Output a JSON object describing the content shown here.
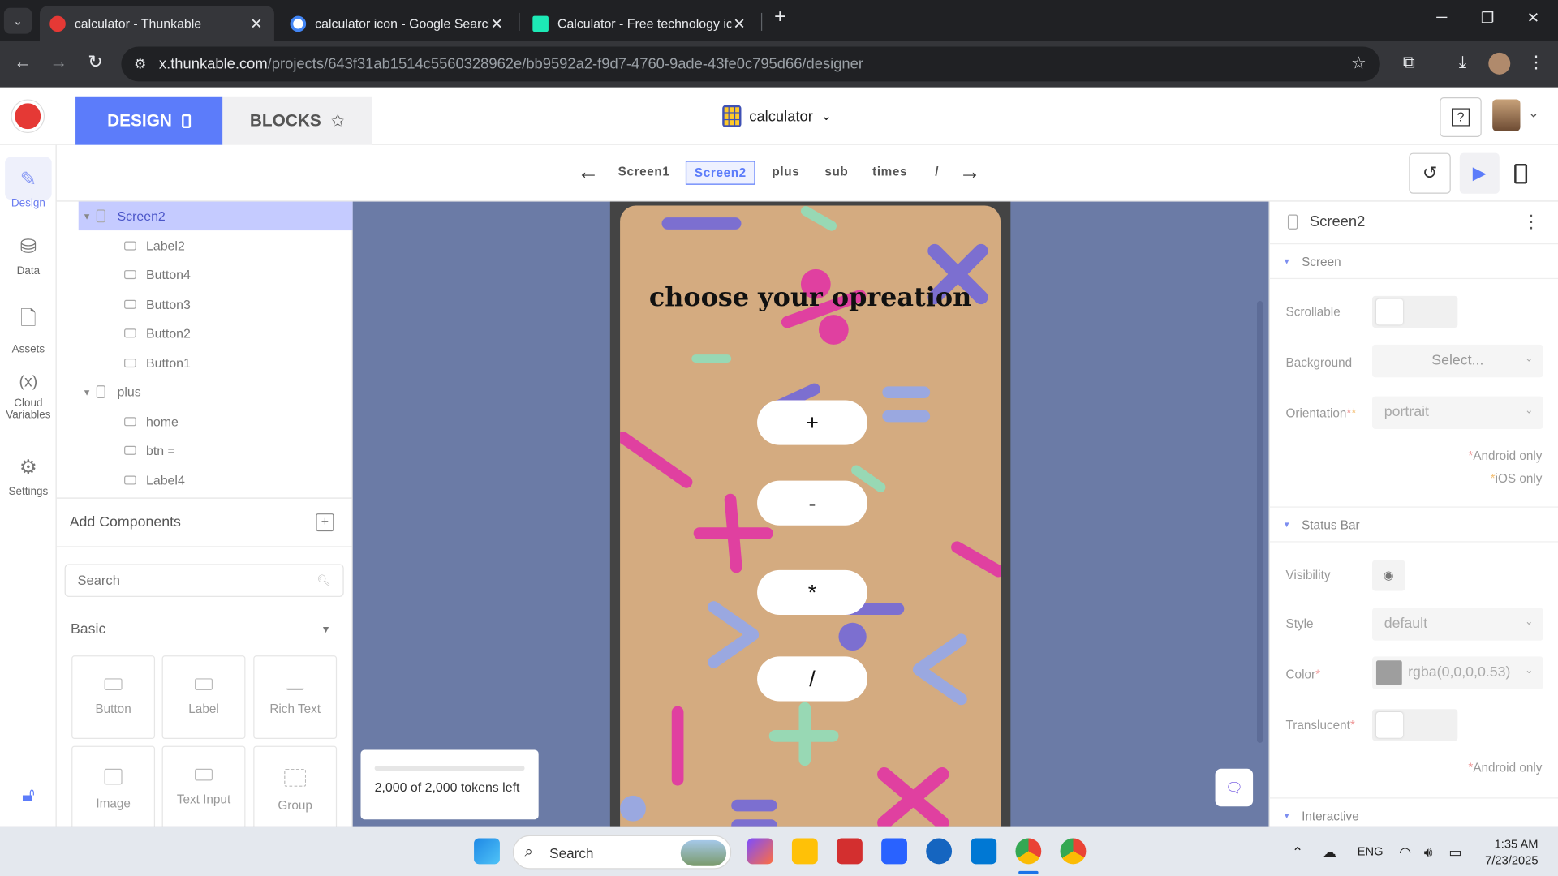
{
  "browser": {
    "tabs": [
      {
        "title": "calculator - Thunkable",
        "active": true
      },
      {
        "title": "calculator icon - Google Search",
        "active": false
      },
      {
        "title": "Calculator - Free technology icons",
        "active": false
      }
    ],
    "new_tab": "+",
    "url_host": "x.thunkable.com",
    "url_path": "/projects/643f31ab1514c5560328962e/bb9592a2-f9d7-4760-9ade-43fe0c795d66/designer"
  },
  "header": {
    "design_label": "DESIGN",
    "blocks_label": "BLOCKS",
    "project_name": "calculator",
    "help": "?"
  },
  "rail": [
    {
      "label": "Design",
      "icon": "brush-icon"
    },
    {
      "label": "Data",
      "icon": "database-icon"
    },
    {
      "label": "Assets",
      "icon": "file-icon"
    },
    {
      "label": "Cloud Variables",
      "icon": "variable-icon",
      "glyph": "(x)"
    },
    {
      "label": "Settings",
      "icon": "gear-icon"
    }
  ],
  "screens": {
    "items": [
      "Screen1",
      "Screen2",
      "plus",
      "sub",
      "times",
      "/"
    ],
    "selected": "Screen2"
  },
  "tree": [
    {
      "label": "Screen2",
      "level": 0,
      "type": "screen",
      "selected": true
    },
    {
      "label": "Label2",
      "level": 1,
      "type": "label"
    },
    {
      "label": "Button4",
      "level": 1,
      "type": "button"
    },
    {
      "label": "Button3",
      "level": 1,
      "type": "button"
    },
    {
      "label": "Button2",
      "level": 1,
      "type": "button"
    },
    {
      "label": "Button1",
      "level": 1,
      "type": "button"
    },
    {
      "label": "plus",
      "level": 0,
      "type": "screen"
    },
    {
      "label": "home",
      "level": 1,
      "type": "button"
    },
    {
      "label": "btn =",
      "level": 1,
      "type": "button"
    },
    {
      "label": "Label4",
      "level": 1,
      "type": "label"
    }
  ],
  "components": {
    "title": "Add Components",
    "search_placeholder": "Search",
    "category": "Basic",
    "items": [
      "Button",
      "Label",
      "Rich Text",
      "Image",
      "Text Input",
      "Group"
    ]
  },
  "preview": {
    "heading": "choose your opreation",
    "buttons": [
      "+",
      "-",
      "*",
      "/"
    ]
  },
  "tokens": {
    "text": "2,000 of 2,000 tokens left",
    "fill_fraction": 0
  },
  "props": {
    "title": "Screen2",
    "sections": {
      "screen": "Screen",
      "status_bar": "Status Bar",
      "interactive": "Interactive"
    },
    "scrollable": "Scrollable",
    "background": "Background",
    "background_value": "Select...",
    "orientation": "Orientation",
    "orientation_value": "portrait",
    "android_only": "Android only",
    "ios_only": "iOS only",
    "visibility": "Visibility",
    "style": "Style",
    "style_value": "default",
    "color": "Color",
    "color_value": "rgba(0,0,0,0.53)",
    "translucent": "Translucent",
    "android_only2": "Android only"
  },
  "taskbar": {
    "search": "Search",
    "lang": "ENG",
    "time": "1:35 AM",
    "date": "7/23/2025"
  },
  "colors": {
    "accent": "#5c7cfa",
    "canvas": "#6b7ba6",
    "screen_bg": "#d4ab80"
  }
}
